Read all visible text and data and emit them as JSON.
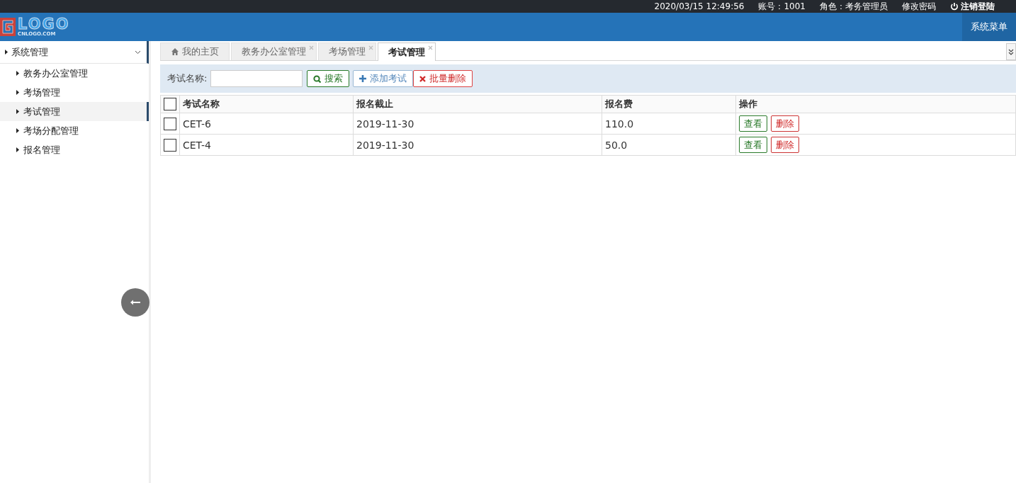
{
  "topbar": {
    "datetime": "2020/03/15 12:49:56",
    "account": "账号：1001",
    "role": "角色：考务管理员",
    "change_password": "修改密码",
    "logout": "注销登陆"
  },
  "header": {
    "logo_main": "LOGO",
    "logo_sub": "CNLOGO.COM",
    "menu_button": "系统菜单"
  },
  "sidebar": {
    "items": [
      {
        "label": "系统管理",
        "expanded": true,
        "children": [
          {
            "label": "教务办公室管理",
            "selected": false
          },
          {
            "label": "考场管理",
            "selected": false
          },
          {
            "label": "考试管理",
            "selected": true
          },
          {
            "label": "考场分配管理",
            "selected": false
          },
          {
            "label": "报名管理",
            "selected": false
          }
        ]
      }
    ]
  },
  "tabs": [
    {
      "label": "我的主页",
      "kind": "home",
      "selected": false
    },
    {
      "label": "教务办公室管理",
      "kind": "closable",
      "selected": false
    },
    {
      "label": "考场管理",
      "kind": "closable",
      "selected": false
    },
    {
      "label": "考试管理",
      "kind": "closable",
      "selected": true
    }
  ],
  "toolbar": {
    "search_label": "考试名称:",
    "search_button": "搜索",
    "add_button": "添加考试",
    "batch_delete_button": "批量删除"
  },
  "table": {
    "columns": [
      "考试名称",
      "报名截止",
      "报名费",
      "操作"
    ],
    "header_checked": false,
    "rows": [
      {
        "checked": false,
        "cells": [
          "CET-6",
          "2019-11-30",
          "110.0"
        ],
        "actions": [
          "查看",
          "删除"
        ]
      },
      {
        "checked": false,
        "cells": [
          "CET-4",
          "2019-11-30",
          "50.0"
        ],
        "actions": [
          "查看",
          "删除"
        ]
      }
    ]
  }
}
